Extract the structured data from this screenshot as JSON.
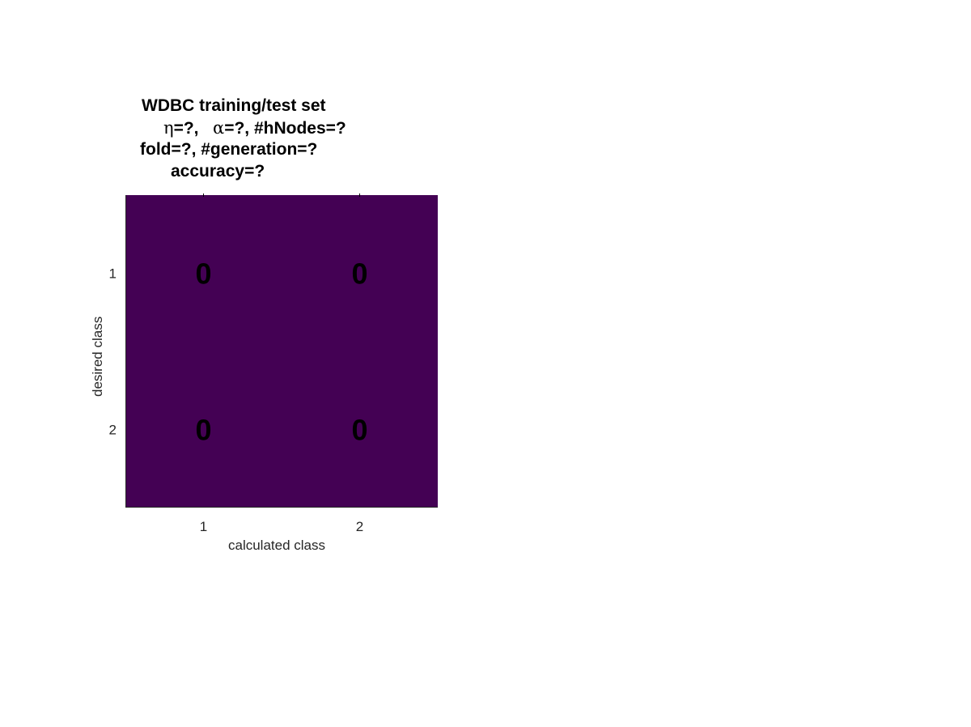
{
  "chart_data": {
    "type": "heatmap",
    "title_lines": [
      {
        "text": "WDBC training/test set"
      },
      {
        "parts": [
          {
            "greek": "η"
          },
          {
            "text": "=?,   "
          },
          {
            "greek": "α"
          },
          {
            "text": "=?, #hNodes=?"
          }
        ]
      },
      {
        "text": "fold=?, #generation=?"
      },
      {
        "text": "accuracy=?"
      }
    ],
    "xlabel": "calculated class",
    "ylabel": "desired class",
    "x_categories": [
      "1",
      "2"
    ],
    "y_categories": [
      "1",
      "2"
    ],
    "matrix": [
      [
        0,
        0
      ],
      [
        0,
        0
      ]
    ],
    "cell_color": "#440154",
    "value_text_color": "#000000",
    "axis_color": "#262626"
  }
}
